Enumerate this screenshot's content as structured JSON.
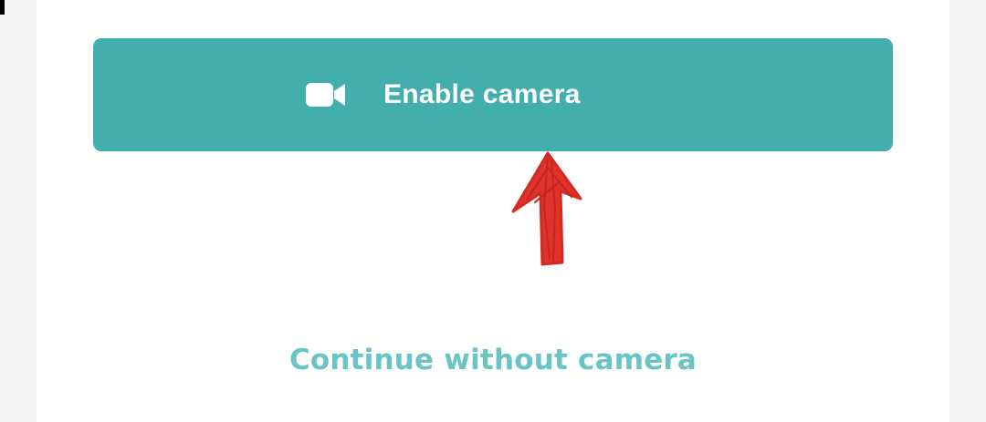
{
  "enable_button": {
    "label": "Enable camera",
    "icon": "video-camera-icon"
  },
  "continue_link": {
    "label": "Continue without camera"
  },
  "annotation": {
    "icon": "red-arrow-up-icon"
  },
  "colors": {
    "page_background": "#f2f4f3",
    "card_background": "#ffffff",
    "button_background": "#42aead",
    "button_text": "#ffffff",
    "link_text": "#69c5c5",
    "arrow": "#e0332b"
  }
}
